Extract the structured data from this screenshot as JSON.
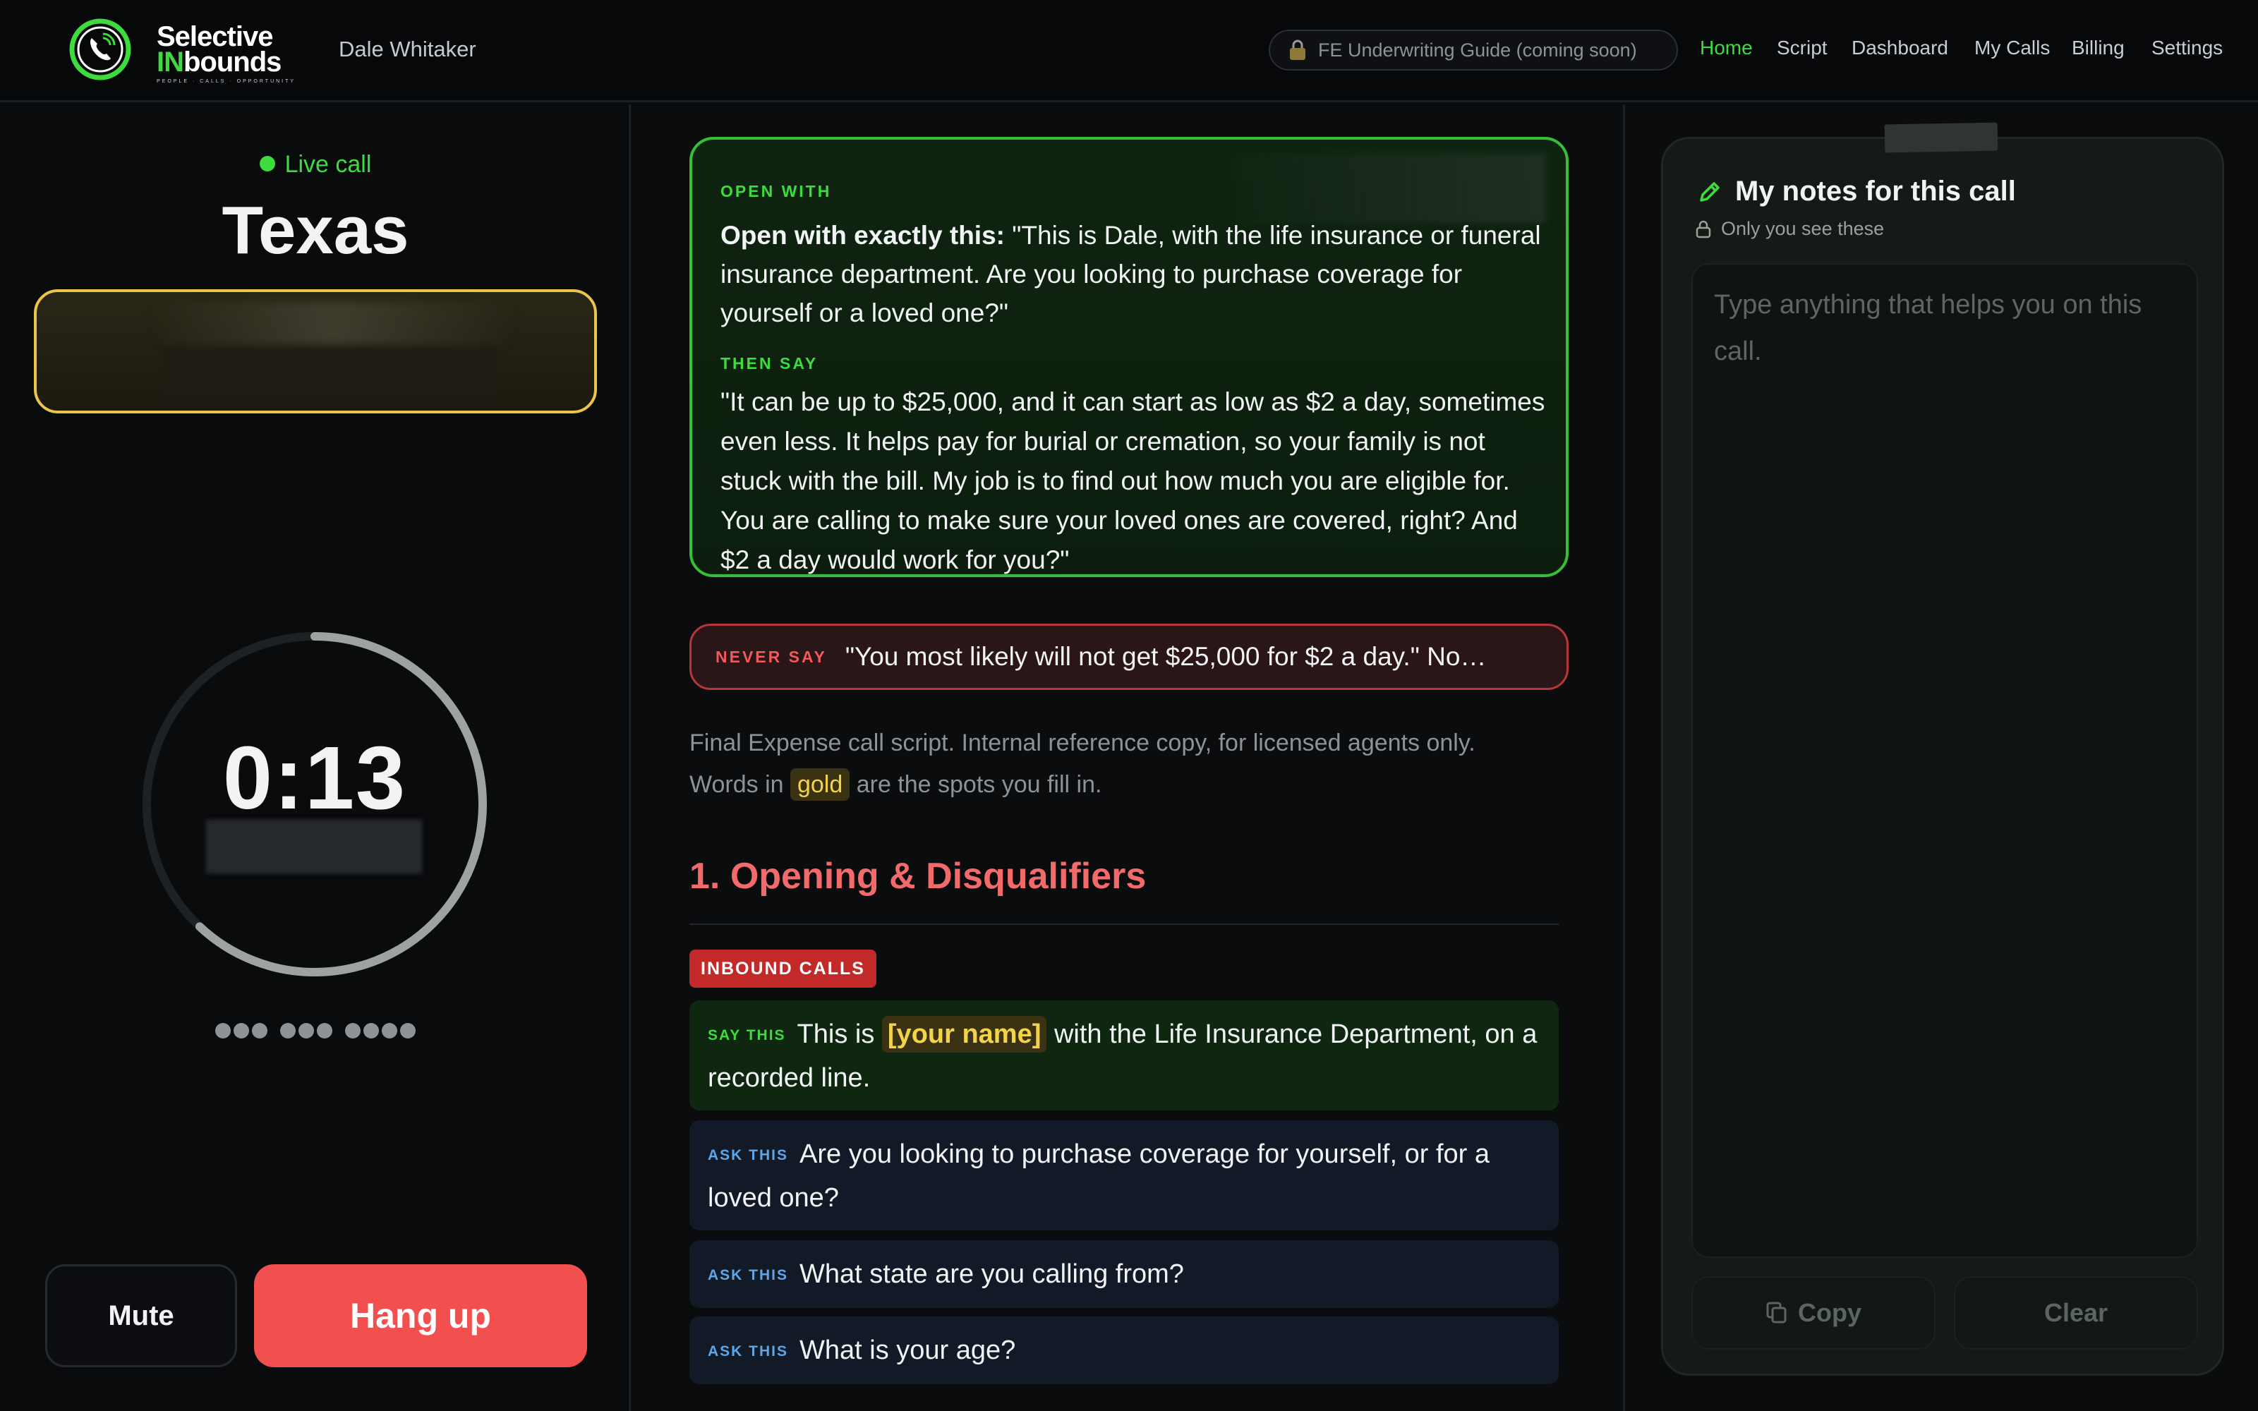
{
  "header": {
    "logo": {
      "line1": "Selective",
      "line2_accent": "IN",
      "line2_rest": "bounds",
      "tagline": "PEOPLE · CALLS · OPPORTUNITY"
    },
    "user_name": "Dale Whitaker",
    "guide_pill": "FE Underwriting Guide (coming soon)",
    "nav": [
      {
        "label": "Home",
        "active": true
      },
      {
        "label": "Script",
        "active": false
      },
      {
        "label": "Dashboard",
        "active": false
      },
      {
        "label": "My Calls",
        "active": false
      },
      {
        "label": "Billing",
        "active": false
      },
      {
        "label": "Settings",
        "active": false
      }
    ],
    "accent_color": "#3ddc3d"
  },
  "call": {
    "status": "Live call",
    "state": "Texas",
    "timer": "0:13",
    "timer_progress": 0.62,
    "masked_number": "●●● ●●● ●●●●",
    "mute_label": "Mute",
    "hangup_label": "Hang up",
    "hangup_color": "#f24f4f"
  },
  "script": {
    "open_label": "OPEN WITH",
    "open_lead": "Open with exactly this:",
    "open_text": " \"This is Dale, with the life insurance or funeral insurance department. Are you looking to purchase coverage for yourself or a loved one?\"",
    "then_label": "THEN SAY",
    "then_text": "\"It can be up to $25,000, and it can start as low as $2 a day, sometimes even less. It helps pay for burial or cremation, so your family is not stuck with the bill. My job is to find out how much you are eligible for. You are calling to make sure your loved ones are covered, right? And $2 a day would work for you?\"",
    "never_label": "NEVER SAY",
    "never_text": "\"You most likely will not get $25,000 for $2 a day.\" No…",
    "intro_1": "Final Expense call script. Internal reference copy, for licensed agents only.",
    "intro_2a": "Words in ",
    "intro_gold": "gold",
    "intro_2b": " are the spots you fill in.",
    "section_title": "1. Opening & Disqualifiers",
    "section_badge": "INBOUND CALLS",
    "lines": [
      {
        "tag": "SAY THIS",
        "pre": "This is ",
        "fill": "[your name]",
        "post": " with the Life Insurance Department, on a recorded line."
      },
      {
        "tag": "ASK THIS",
        "text": "Are you looking to purchase coverage for yourself, or for a loved one?"
      },
      {
        "tag": "ASK THIS",
        "text": "What state are you calling from?"
      },
      {
        "tag": "ASK THIS",
        "text": "What is your age?"
      }
    ]
  },
  "notes": {
    "title": "My notes for this call",
    "subtitle": "Only you see these",
    "placeholder": "Type anything that helps you on this call.",
    "copy_label": "Copy",
    "clear_label": "Clear"
  }
}
